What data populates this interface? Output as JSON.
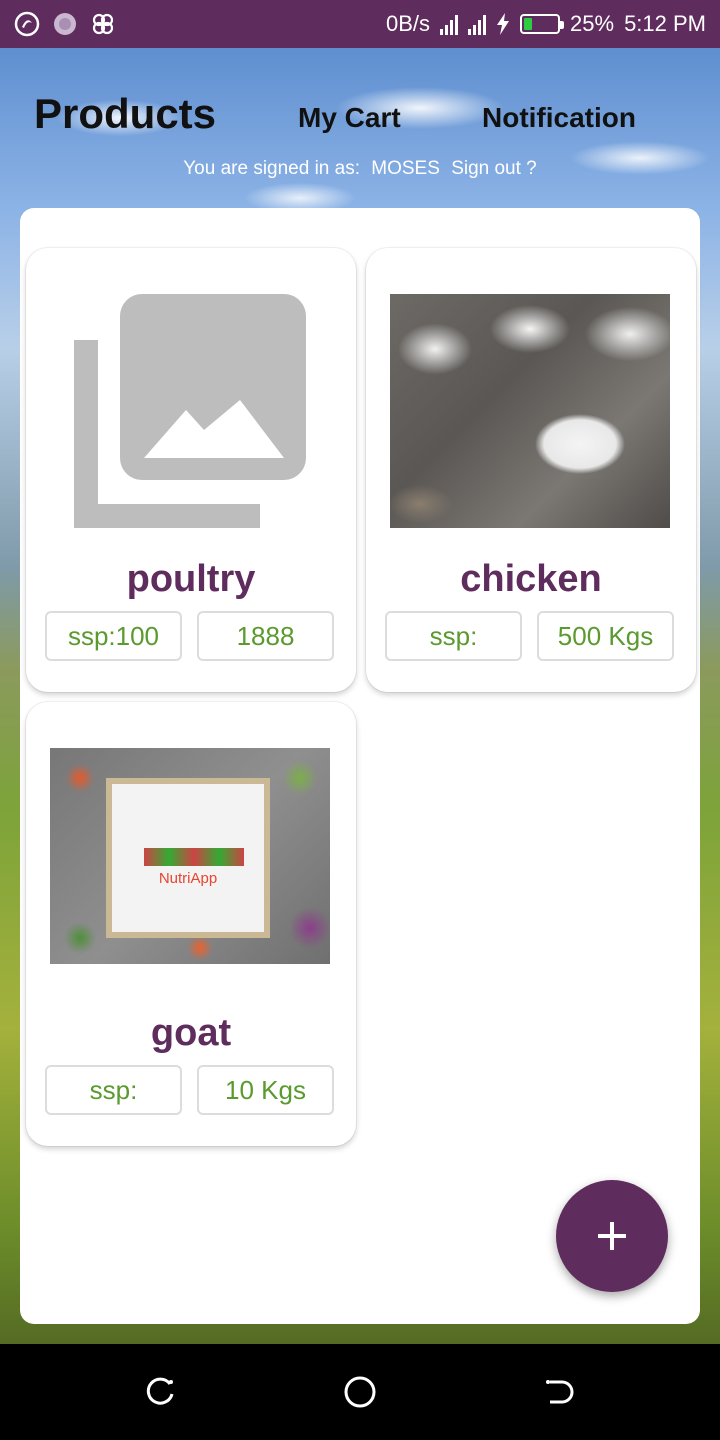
{
  "status_bar": {
    "network_speed": "0B/s",
    "battery_percent": "25%",
    "battery_level": 0.25,
    "time": "5:12 PM",
    "icons": [
      "app-logo-icon",
      "sticker-icon",
      "pinwheel-icon",
      "hd-signal-icon",
      "r-signal-icon",
      "charging-icon",
      "battery-icon"
    ]
  },
  "header": {
    "title": "Products",
    "tabs": [
      "My Cart",
      "Notification"
    ],
    "signed_in_label": "You are signed in as:",
    "user_name": "MOSES",
    "sign_out_label": "Sign out ?"
  },
  "products": [
    {
      "name": "poultry",
      "price": "ssp:100",
      "quantity": "1888",
      "image": "placeholder-image-icon"
    },
    {
      "name": "chicken",
      "price": "ssp:",
      "quantity": "500 Kgs",
      "image": "chicken-photo"
    },
    {
      "name": "goat",
      "price": "ssp:",
      "quantity": "10 Kgs",
      "image": "nutriapp-photo",
      "image_brand_text": "NutriApp"
    }
  ],
  "fab": {
    "icon": "plus-icon"
  },
  "nav": {
    "icons": [
      "recent-apps-icon",
      "home-icon",
      "back-icon"
    ]
  },
  "colors": {
    "primary": "#5e2c5d",
    "accent_text": "#5a9a2e"
  }
}
